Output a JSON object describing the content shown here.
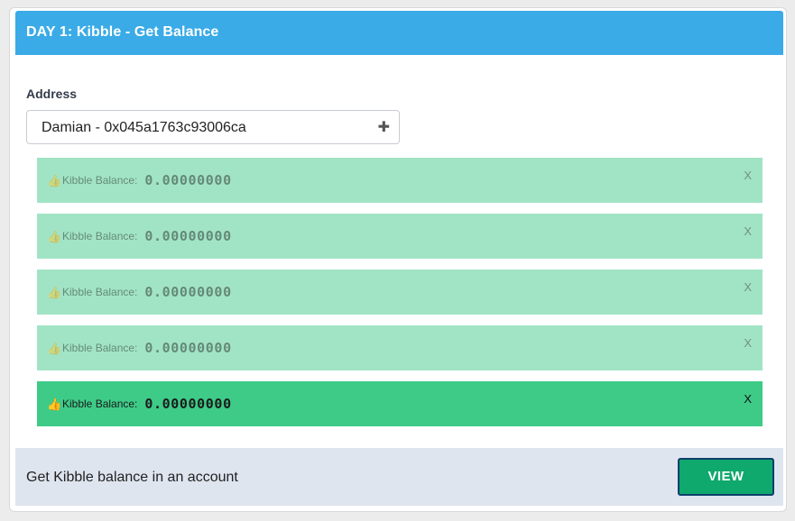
{
  "header": {
    "title": "DAY 1: Kibble - Get Balance",
    "bg_color": "#3aabe6"
  },
  "form": {
    "address_label": "Address",
    "address_value": "Damian - 0x045a1763c93006ca",
    "address_action_icon": "plus-icon"
  },
  "alerts": [
    {
      "label": "Kibble Balance:",
      "value": "0.00000000",
      "close": "X",
      "active": false
    },
    {
      "label": "Kibble Balance:",
      "value": "0.00000000",
      "close": "X",
      "active": false
    },
    {
      "label": "Kibble Balance:",
      "value": "0.00000000",
      "close": "X",
      "active": false
    },
    {
      "label": "Kibble Balance:",
      "value": "0.00000000",
      "close": "X",
      "active": false
    },
    {
      "label": "Kibble Balance:",
      "value": "0.00000000",
      "close": "X",
      "active": true
    }
  ],
  "footer": {
    "description": "Get Kibble balance in an account",
    "button_label": "VIEW",
    "button_color": "#0fa96d"
  },
  "colors": {
    "alert_faded": "#a1e4c5",
    "alert_active": "#3ecb88",
    "footer_bg": "#dfe5ef"
  }
}
